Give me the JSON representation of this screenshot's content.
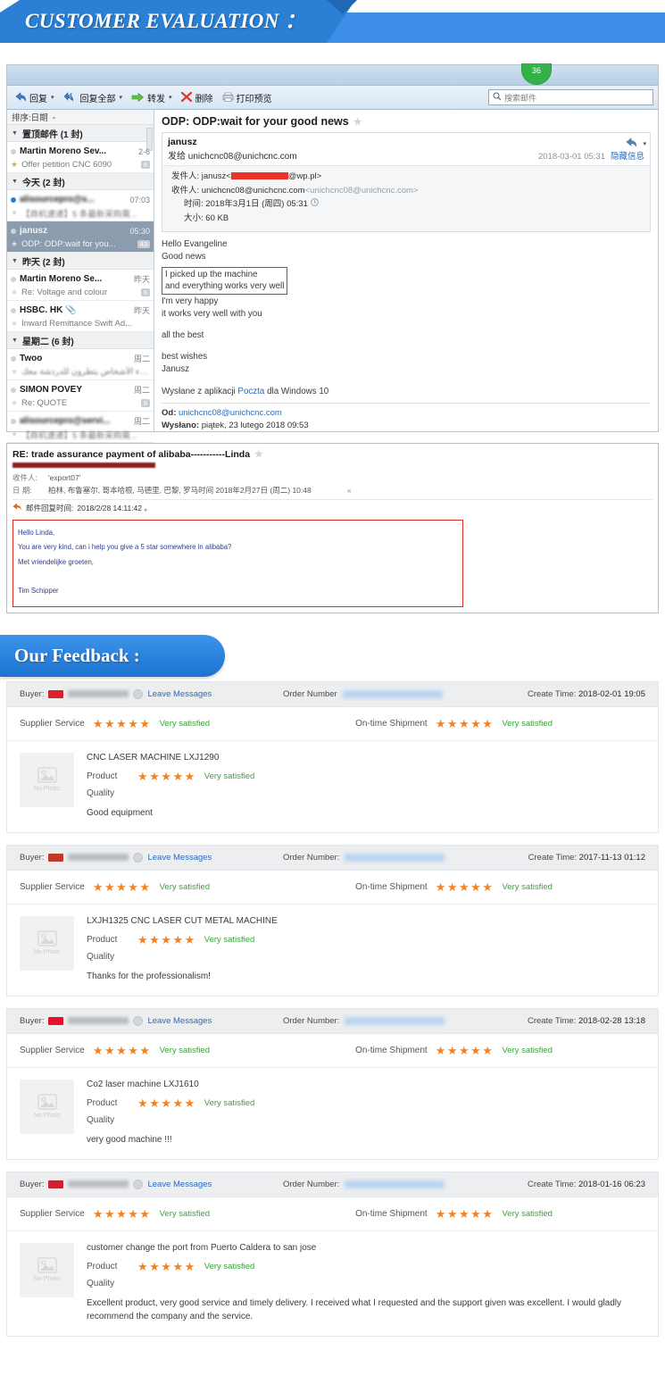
{
  "banner": {
    "title": "CUSTOMER EVALUATION ："
  },
  "mail": {
    "badge_count": "36",
    "toolbar": [
      {
        "label": "回复",
        "icon": "reply-icon",
        "caret": "▾"
      },
      {
        "label": "回复全部",
        "icon": "reply-all-icon",
        "caret": "▾"
      },
      {
        "label": "转发",
        "icon": "forward-icon",
        "caret": "▾"
      },
      {
        "label": "删除",
        "icon": "delete-icon",
        "caret": ""
      },
      {
        "label": "打印预览",
        "icon": "print-preview-icon",
        "caret": ""
      }
    ],
    "search": {
      "placeholder": "搜索邮件",
      "icon": "search-icon"
    },
    "list": {
      "sort_label": "排序:日期",
      "groups": [
        {
          "header": "置顶邮件 (1 封)",
          "items": [
            {
              "name": "Martin Moreno Sev...",
              "date": "2-6",
              "subject": "Offer petition CNC 6090",
              "count": "6",
              "unread": false,
              "starred": true,
              "blurred": false,
              "selected": false
            }
          ]
        },
        {
          "header": "今天 (2 封)",
          "items": [
            {
              "name": "alisourcepro@s...",
              "date": "07:03",
              "subject": "【商机速递】5 条最新采购需...",
              "count": "",
              "unread": true,
              "starred": false,
              "blurred": true,
              "selected": false
            },
            {
              "name": "janusz",
              "date": "05:30",
              "subject": "ODP: ODP:wait for you...",
              "count": "43",
              "unread": false,
              "starred": false,
              "blurred": false,
              "selected": true
            }
          ]
        },
        {
          "header": "昨天 (2 封)",
          "items": [
            {
              "name": "Martin Moreno Se...",
              "date": "昨天",
              "subject": "Re: Voltage and colour",
              "count": "6",
              "unread": false,
              "starred": false,
              "blurred": false,
              "selected": false
            },
            {
              "name": "HSBC. HK 📎",
              "date": "昨天",
              "subject": "Inward Remittance Swift Ad...",
              "count": "",
              "unread": false,
              "starred": false,
              "blurred": false,
              "selected": false
            }
          ]
        },
        {
          "header": "星期二 (6 封)",
          "items": [
            {
              "name": "Twoo",
              "date": "周二",
              "subject": "الاعزاء الأشخاص يتظرون للدردشة معك ⚡",
              "count": "",
              "unread": false,
              "starred": false,
              "blurred": false,
              "selected": false
            },
            {
              "name": "SIMON POVEY",
              "date": "周二",
              "subject": "Re: QUOTE",
              "count": "8",
              "unread": false,
              "starred": false,
              "blurred": false,
              "selected": false
            },
            {
              "name": "alisourcepro@servi...",
              "date": "周二",
              "subject": "【商机速递】5 条最新采购需...",
              "count": "",
              "unread": false,
              "starred": false,
              "blurred": true,
              "selected": false
            }
          ]
        }
      ]
    },
    "reading": {
      "subject": "ODP: ODP:wait for your good news",
      "from_name": "janusz",
      "to_line_prefix": "发给",
      "to_address": "unichcnc08@unichcnc.com",
      "timestamp": "2018-03-01 05:31",
      "hide_info": "隐藏信息",
      "detail": {
        "sender_label": "发件人:",
        "sender_value_prefix": "janusz<",
        "sender_value_suffix": "@wp.pl>",
        "recipient_label": "收件人:",
        "recipient_value": "unichcnc08@unichcnc.com",
        "recipient_value_gray": "<unichcnc08@unichcnc.com>",
        "time_label": "时间:",
        "time_value": "2018年3月1日 (周四) 05:31",
        "size_label": "大小:",
        "size_value": "60 KB"
      },
      "body": {
        "greeting": "Hello Evangeline",
        "line_good_news": "Good news",
        "highlight_line1": "I picked up the machine",
        "highlight_line2": "and everything works very well",
        "line_happy": "I'm very happy",
        "line_works": "it works very well with you",
        "line_allbest": "all the best",
        "line_bestwishes": "best wishes",
        "line_signature": "Janusz",
        "sent_from_pre": "Wysłane z aplikacji ",
        "sent_from_link": "Poczta",
        "sent_from_post": " dla Windows 10",
        "od_label": "Od:",
        "od_value": "unichcnc08@unichcnc.com",
        "wyslano_label": "Wysłano:",
        "wyslano_value": "piątek, 23 lutego 2018 09:53"
      }
    }
  },
  "mail2": {
    "subject": "RE: trade assurance payment of alibaba-----------Linda",
    "to_label": "收件人:",
    "to_value": "'export07'",
    "date_label": "日   期:",
    "date_value": "柏林, 布鲁塞尔, 哥本哈根, 马德里, 巴黎, 罗马时间 2018年2月27日 (周二) 10:48",
    "collapse_icon": "«",
    "reply_label": "邮件回复时间:",
    "reply_value": "2018/2/28 14:11:42 。",
    "body": [
      "Hello Linda,",
      "You are very kind, can i help you give a 5 star somewhere in alibaba?",
      "Met vriendelijke groeten,",
      "",
      "Tim Schipper"
    ]
  },
  "feedback_banner": {
    "title": "Our Feedback :"
  },
  "feedback": {
    "labels": {
      "buyer": "Buyer:",
      "leave_messages": "Leave Messages",
      "order_number": "Order Number",
      "order_number_colon": "Order Number:",
      "create_time": "Create Time:",
      "supplier_service": "Supplier Service",
      "on_time_shipment": "On-time Shipment",
      "product": "Product",
      "quality": "Quality",
      "no_photo": "No Photo",
      "stars": "★★★★★",
      "very_satisfied": "Very satisfied"
    },
    "cards": [
      {
        "create_time": "2018-02-01 19:05",
        "order_label": "Order Number",
        "flag_color": "#d8232a",
        "supplier_service_rating": "Very satisfied",
        "on_time_rating": "Very satisfied",
        "product_title": "CNC LASER MACHINE LXJ1290",
        "product_rating": "Very satisfied",
        "comment": "Good equipment"
      },
      {
        "create_time": "2017-11-13 01:12",
        "order_label": "Order Number:",
        "flag_color": "#c0392b",
        "supplier_service_rating": "Very satisfied",
        "on_time_rating": "Very satisfied",
        "product_title": "LXJH1325 CNC LASER CUT METAL MACHINE",
        "product_rating": "Very satisfied",
        "comment": "Thanks for the professionalism!"
      },
      {
        "create_time": "2018-02-28 13:18",
        "order_label": "Order Number:",
        "flag_color": "#e8112d",
        "supplier_service_rating": "Very satisfied",
        "on_time_rating": "Very satisfied",
        "product_title": "Co2 laser machine LXJ1610",
        "product_rating": "Very satisfied",
        "comment": "very good machine !!!"
      },
      {
        "create_time": "2018-01-16 06:23",
        "order_label": "Order Number:",
        "flag_color": "#cc2233",
        "supplier_service_rating": "Very satisfied",
        "on_time_rating": "Very satisfied",
        "product_title": "customer change the port from Puerto Caldera to san jose",
        "product_rating": "Very satisfied",
        "comment": "Excellent product, very good service and timely delivery. I received what I requested and the support given was excellent. I would gladly recommend the company and the service."
      }
    ]
  },
  "colors": {
    "banner_blue": "#3d8fe8",
    "banner_dark_blue": "#2b7fd4",
    "star_orange": "#f5821f",
    "satisfied_green": "#3aa33a",
    "link_blue": "#2a6bbd",
    "highlight_red": "#e02b20",
    "badge_green": "#33b249"
  }
}
